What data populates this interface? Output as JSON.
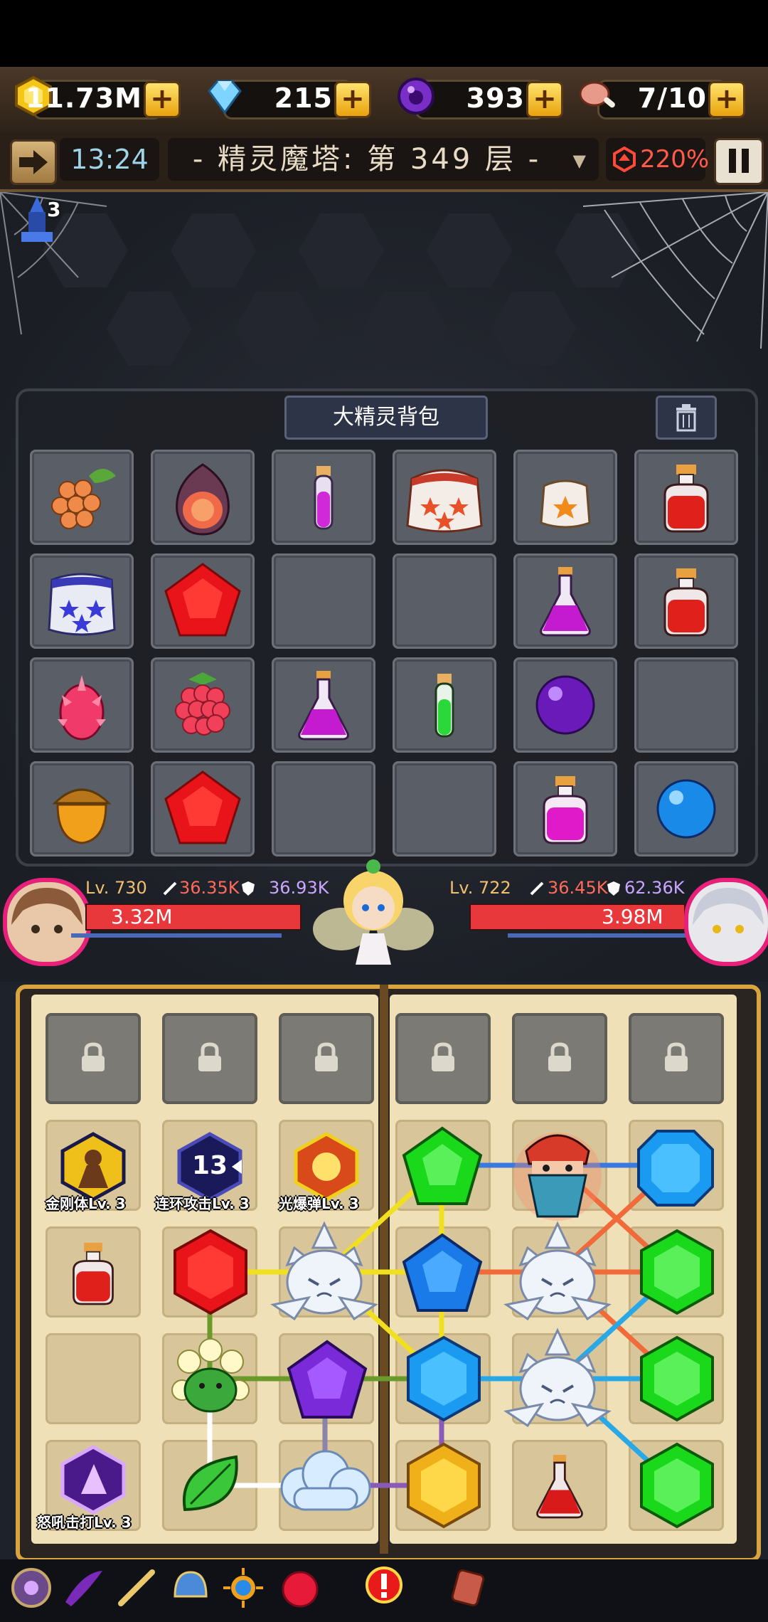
{
  "resources": {
    "gold": "11.73M",
    "diamond": "215",
    "orb": "393",
    "stamina": "7/10",
    "plus_label": "+"
  },
  "info": {
    "clock": "13:24",
    "floor_title": "- 精灵魔塔: 第 349 层 -",
    "percent": "220%"
  },
  "tower_badge": "3",
  "backpack": {
    "title": "大精灵背包",
    "slots": [
      "grapes",
      "fig",
      "purple-vial",
      "red-star-sack",
      "orange-star-sack",
      "red-potion",
      "blue-star-sack",
      "red-gem",
      "empty",
      "empty",
      "purple-flask",
      "red-potion",
      "dragon-fruit",
      "raspberry",
      "purple-flask",
      "green-vial",
      "purple-orb",
      "empty",
      "acorn",
      "red-gem",
      "empty",
      "empty",
      "magenta-potion",
      "blue-orb"
    ]
  },
  "player": {
    "level": "Lv. 730",
    "attack": "36.35K",
    "defense": "36.93K",
    "hp": "3.32M"
  },
  "enemy": {
    "level": "Lv. 722",
    "attack": "36.45K",
    "defense": "62.36K",
    "hp": "3.98M"
  },
  "board": {
    "skills": {
      "s1": "金刚体Lv. 3",
      "s2": "连环攻击Lv. 3",
      "s2_count": "13",
      "s3": "光爆弹Lv. 3",
      "s4": "怒吼击打Lv. 3"
    }
  },
  "colors": {
    "hp": "#e8383c",
    "gold_accent": "#d9a440",
    "panel": "#f0e0b8"
  }
}
